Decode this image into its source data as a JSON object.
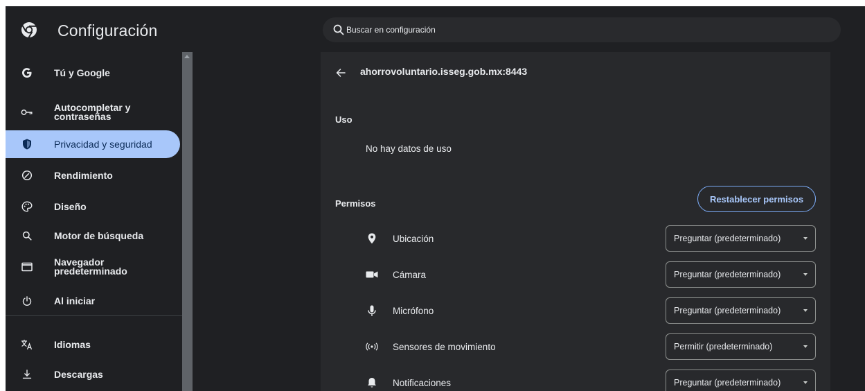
{
  "app": {
    "title": "Configuración"
  },
  "search": {
    "placeholder": "Buscar en configuración"
  },
  "sidebar": {
    "items": [
      {
        "label": "Tú y Google",
        "icon": "google-g-icon",
        "active": false
      },
      {
        "label": "Autocompletar y contraseñas",
        "icon": "key-icon",
        "active": false
      },
      {
        "label": "Privacidad y seguridad",
        "icon": "shield-icon",
        "active": true
      },
      {
        "label": "Rendimiento",
        "icon": "speedometer-icon",
        "active": false
      },
      {
        "label": "Diseño",
        "icon": "palette-icon",
        "active": false
      },
      {
        "label": "Motor de búsqueda",
        "icon": "search-icon",
        "active": false
      },
      {
        "label": "Navegador predeterminado",
        "icon": "browser-window-icon",
        "active": false
      },
      {
        "label": "Al iniciar",
        "icon": "power-icon",
        "active": false
      },
      {
        "label": "Idiomas",
        "icon": "translate-icon",
        "active": false
      },
      {
        "label": "Descargas",
        "icon": "download-icon",
        "active": false
      }
    ]
  },
  "site": {
    "origin": "ahorrovoluntario.isseg.gob.mx:8443"
  },
  "usage": {
    "heading": "Uso",
    "text": "No hay datos de uso"
  },
  "permissions": {
    "heading": "Permisos",
    "reset_label": "Restablecer permisos",
    "rows": [
      {
        "label": "Ubicación",
        "icon": "location-pin-icon",
        "value": "Preguntar (predeterminado)"
      },
      {
        "label": "Cámara",
        "icon": "camera-icon",
        "value": "Preguntar (predeterminado)"
      },
      {
        "label": "Micrófono",
        "icon": "microphone-icon",
        "value": "Preguntar (predeterminado)"
      },
      {
        "label": "Sensores de movimiento",
        "icon": "motion-sensor-icon",
        "value": "Permitir (predeterminado)"
      },
      {
        "label": "Notificaciones",
        "icon": "bell-icon",
        "value": "Preguntar (predeterminado)"
      }
    ]
  },
  "colors": {
    "background": "#1f2023",
    "card": "#28292c",
    "accent": "#a8c7fa",
    "active_text": "#0b2b57"
  }
}
